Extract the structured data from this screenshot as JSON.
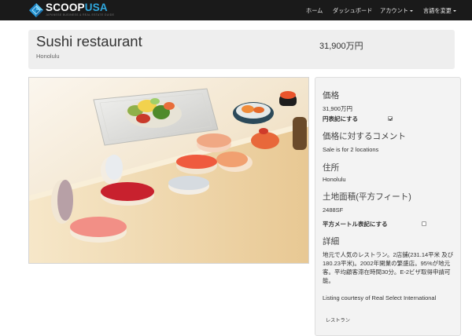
{
  "navbar": {
    "logo_scoop": "SCOOP",
    "logo_usa": "USA",
    "logo_tagline": "JAPANESE BUSINESS & REAL ESTATE GUIDE",
    "items": [
      {
        "label": "ホーム"
      },
      {
        "label": "ダッシュボード"
      },
      {
        "label": "アカウント"
      },
      {
        "label": "言語を変更"
      }
    ]
  },
  "listing": {
    "title": "Sushi restaurant",
    "location": "Honolulu",
    "price_header": "31,900万円"
  },
  "details": {
    "price_label": "価格",
    "price_value": "31,900万円",
    "yen_toggle_label": "円表記にする",
    "yen_toggle_checked": true,
    "comment_label": "価格に対するコメント",
    "comment_value": "Sale is for 2 locations",
    "address_label": "住所",
    "address_value": "Honolulu",
    "land_label": "土地面積(平方フィート)",
    "land_value": "2488SF",
    "sqm_toggle_label": "平方メートル表記にする",
    "sqm_toggle_checked": false,
    "detail_label": "詳細",
    "detail_text": "地元で人気のレストラン。2店舗(231.14平米 及び180.23平米)。2002年開業の繁盛店。95%が地元客。平均顧客滞在時間30分。E-2ビザ取得申請可能。",
    "courtesy": "Listing courtesy of Real Select International",
    "category_tag": "レストラン"
  },
  "colors": {
    "navbar_bg": "#1a1a1a",
    "brand_blue": "#2fa8df",
    "panel_bg": "#eeeeee"
  }
}
